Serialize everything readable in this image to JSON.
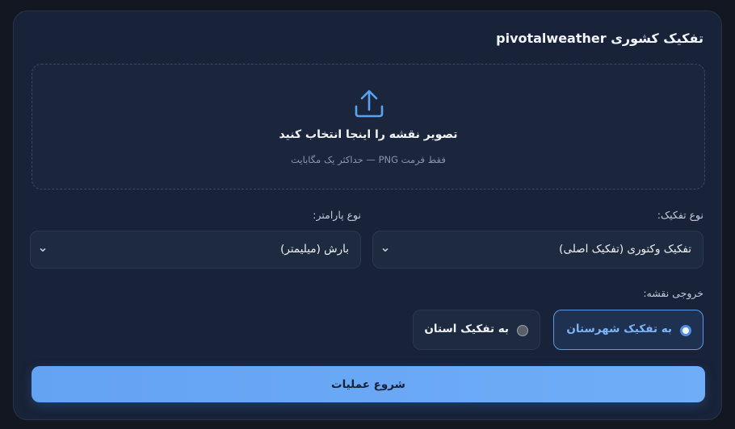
{
  "card": {
    "title": "تفکیک کشوری pivotalweather"
  },
  "dropzone": {
    "icon": "upload-icon",
    "title": "تصویر نقشه را اینجا انتخاب کنید",
    "hint": "فقط فرمت PNG — حداکثر یک مگابایت"
  },
  "fields": {
    "separation_type": {
      "label": "نوع تفکیک:",
      "selected": "تفکیک وکتوری (تفکیک اصلی)"
    },
    "parameter_type": {
      "label": "نوع پارامتر:",
      "selected": "بارش (میلیمتر)"
    }
  },
  "output": {
    "label": "خروجی نقشه:",
    "options": [
      {
        "label": "به تفکیک شهرستان",
        "selected": true
      },
      {
        "label": "به تفکیک استان",
        "selected": false
      }
    ]
  },
  "start_button": {
    "label": "شروع عملیات"
  },
  "colors": {
    "background": "#121722",
    "card": "#182238",
    "accent": "#6aa8f6",
    "selected_border": "#5c9ae4"
  }
}
